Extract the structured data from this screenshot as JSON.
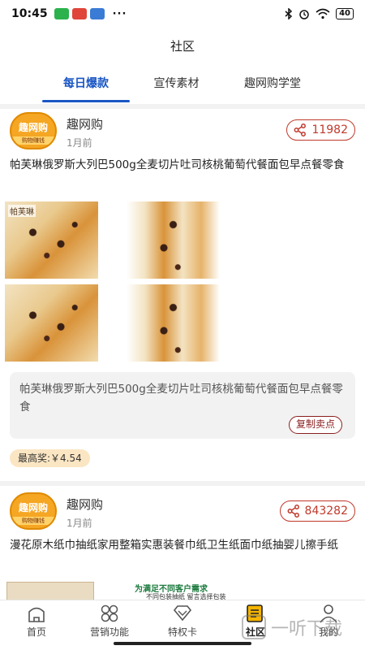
{
  "status_bar": {
    "time": "10:45",
    "battery": "40"
  },
  "header": {
    "title": "社区"
  },
  "tabs": [
    {
      "label": "每日爆款",
      "active": true
    },
    {
      "label": "宣传素材",
      "active": false
    },
    {
      "label": "趣网购学堂",
      "active": false
    }
  ],
  "avatar": {
    "top": "趣网购",
    "bottom": "购物赚钱"
  },
  "posts": [
    {
      "author": "趣网购",
      "time": "1月前",
      "share_count": "11982",
      "description": "帕芙琳俄罗斯大列巴500g全麦切片吐司核桃葡萄代餐面包早点餐零食",
      "image_brand": "帕芙琳",
      "copy_text": "帕芙琳俄罗斯大列巴500g全麦切片吐司核桃葡萄代餐面包早点餐零食",
      "copy_button": "复制卖点",
      "prize": "最高奖:￥4.54"
    },
    {
      "author": "趣网购",
      "time": "1月前",
      "share_count": "843282",
      "description": "漫花原木纸巾抽纸家用整箱实惠装餐巾纸卫生纸面巾纸抽婴儿擦手纸",
      "promo_line1": "为满足不同客户需求",
      "promo_line2": "不同包装抽纸 留言选择包装"
    }
  ],
  "bottom_nav": [
    {
      "label": "首页",
      "icon": "home-icon",
      "active": false
    },
    {
      "label": "营销功能",
      "icon": "grid-clover-icon",
      "active": false
    },
    {
      "label": "特权卡",
      "icon": "diamond-icon",
      "active": false
    },
    {
      "label": "社区",
      "icon": "community-icon",
      "active": true
    },
    {
      "label": "我的",
      "icon": "user-icon",
      "active": false
    }
  ],
  "watermark": "一听下载",
  "colors": {
    "accent": "#1a56c4",
    "share": "#c0392b",
    "badge_bg": "#fbe6c3",
    "active_nav": "#f5b400"
  }
}
